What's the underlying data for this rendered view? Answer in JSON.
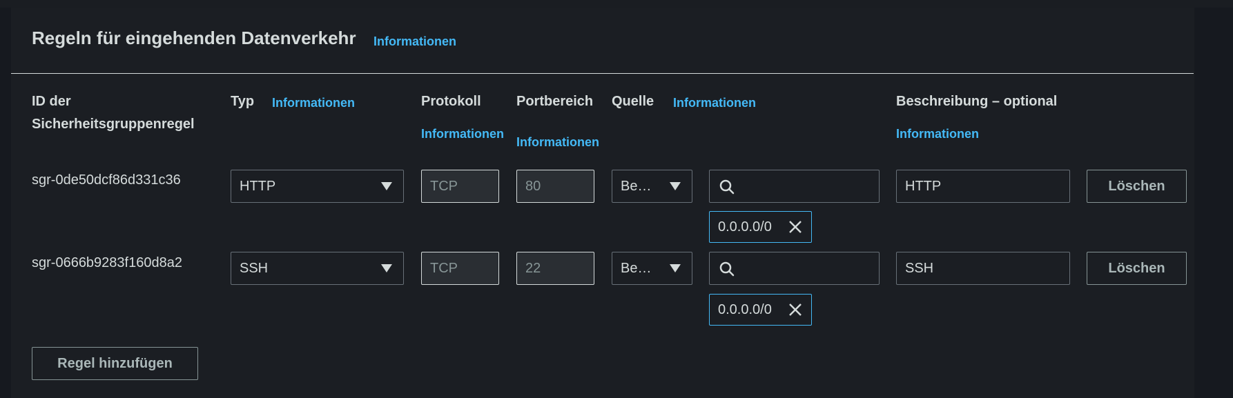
{
  "title": "Regeln für eingehenden Datenverkehr",
  "title_info": "Informationen",
  "headers": {
    "rule_id": "ID der Sicherheitsgruppenregel",
    "type": "Typ",
    "type_info": "Informationen",
    "protocol": "Protokoll",
    "protocol_info": "Informationen",
    "port_range": "Portbereich",
    "port_range_info": "Informationen",
    "source": "Quelle",
    "source_info": "Informationen",
    "description": "Beschreibung – optional",
    "description_info": "Informationen"
  },
  "rules": [
    {
      "id": "sgr-0de50dcf86d331c36",
      "type": "HTTP",
      "protocol": "TCP",
      "port": "80",
      "source_type": "Be…",
      "search_value": "",
      "cidr": "0.0.0.0/0",
      "description": "HTTP",
      "delete_label": "Löschen"
    },
    {
      "id": "sgr-0666b9283f160d8a2",
      "type": "SSH",
      "protocol": "TCP",
      "port": "22",
      "source_type": "Be…",
      "search_value": "",
      "cidr": "0.0.0.0/0",
      "description": "SSH",
      "delete_label": "Löschen"
    }
  ],
  "add_rule_label": "Regel hinzufügen",
  "colors": {
    "background": "#1b1e23",
    "link": "#44b9f6",
    "text": "#d5dbdb",
    "token_border": "#44b9f6"
  }
}
